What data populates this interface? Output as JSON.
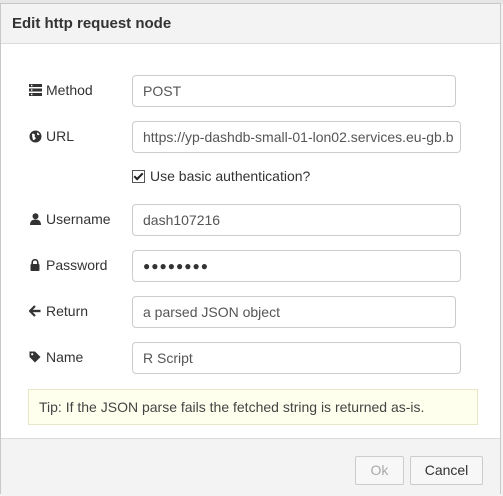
{
  "dialog": {
    "title": "Edit http request node"
  },
  "form": {
    "method": {
      "label": "Method",
      "value": "POST",
      "icon": "list-icon"
    },
    "url": {
      "label": "URL",
      "value": "https://yp-dashdb-small-01-lon02.services.eu-gb.b",
      "icon": "globe-icon"
    },
    "basic_auth": {
      "label": "Use basic authentication?",
      "checked": true
    },
    "username": {
      "label": "Username",
      "value": "dash107216",
      "icon": "user-icon"
    },
    "password": {
      "label": "Password",
      "value": "●●●●●●●●",
      "icon": "lock-icon"
    },
    "return": {
      "label": "Return",
      "value": "a parsed JSON object",
      "icon": "arrow-left-icon"
    },
    "name": {
      "label": "Name",
      "value": "R Script",
      "icon": "tag-icon"
    }
  },
  "tip": "Tip: If the JSON parse fails the fetched string is returned as-is.",
  "footer": {
    "ok_label": "Ok",
    "cancel_label": "Cancel"
  },
  "colors": {
    "tip_background": "#ffffee",
    "titlebar_background": "#f3f3f3"
  }
}
